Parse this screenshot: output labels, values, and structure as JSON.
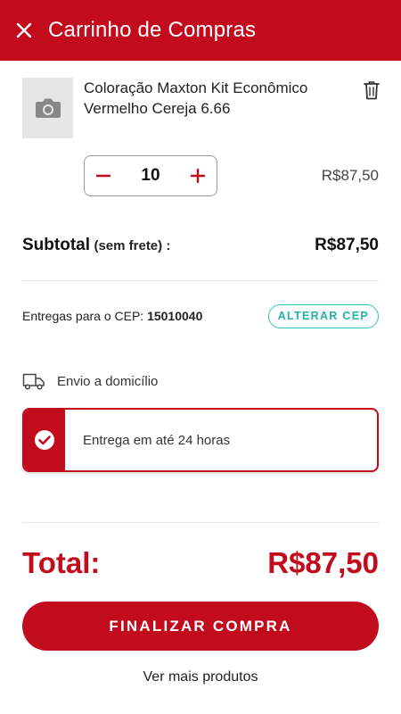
{
  "header": {
    "title": "Carrinho de Compras",
    "close_icon": "close-icon"
  },
  "product": {
    "name": "Coloração Maxton Kit Econômico Vermelho Cereja 6.66",
    "quantity": "10",
    "price": "R$87,50",
    "thumb_icon": "camera-icon",
    "delete_icon": "trash-icon"
  },
  "subtotal": {
    "label": "Subtotal",
    "note": "(sem frete) :",
    "value": "R$87,50"
  },
  "delivery": {
    "cep_prefix": "Entregas para o CEP:",
    "cep": "15010040",
    "change_cep_label": "ALTERAR CEP",
    "method_label": "Envio a domicílio",
    "option_label": "Entrega em até 24 horas"
  },
  "total": {
    "label": "Total:",
    "value": "R$87,50"
  },
  "actions": {
    "finalize_label": "FINALIZAR COMPRA",
    "more_products_label": "Ver mais produtos"
  },
  "colors": {
    "brand": "#c20c1e",
    "accent": "#2cc5b8",
    "thumb_bg": "#e6e6e6"
  }
}
